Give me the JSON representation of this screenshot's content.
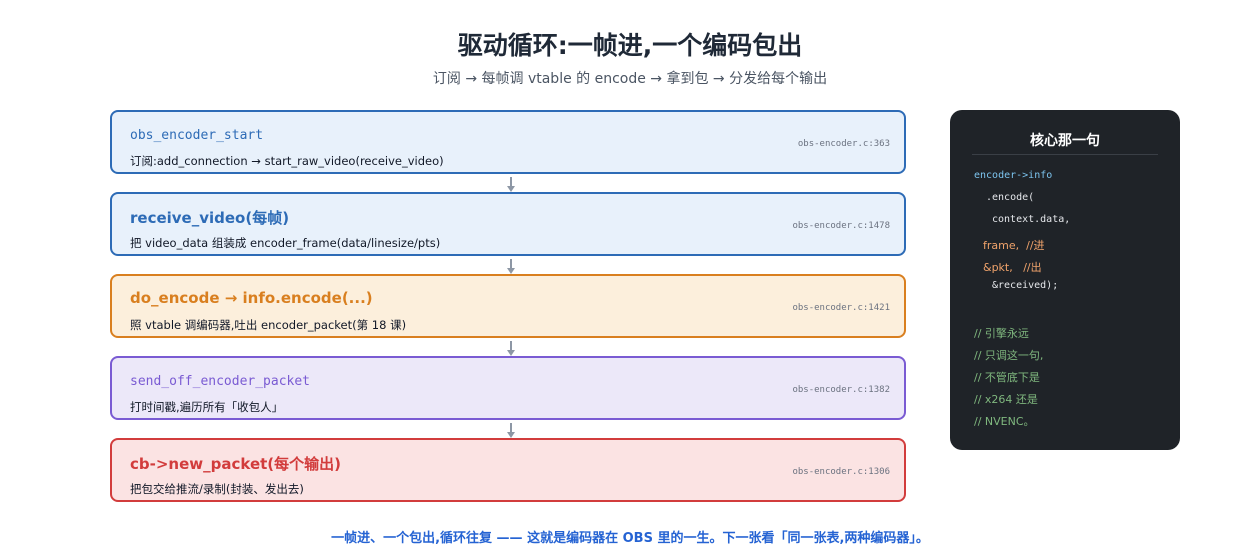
{
  "title": "驱动循环:一帧进,一个编码包出",
  "subtitle": "订阅 → 每帧调 vtable 的 encode → 拿到包 → 分发给每个输出",
  "colors": {
    "blue": "#2d6bb6",
    "orange": "#d97f1f",
    "purple": "#7a5bd3",
    "red": "#d23c3c",
    "panel_bg": "#1f2328",
    "footer": "#2563d3"
  },
  "steps": [
    {
      "name": "obs_encoder_start",
      "desc": "订阅:add_connection → start_raw_video(receive_video)",
      "ref": "obs-encoder.c:363"
    },
    {
      "name": "receive_video(每帧)",
      "desc": "把 video_data 组装成 encoder_frame(data/linesize/pts)",
      "ref": "obs-encoder.c:1478"
    },
    {
      "name": "do_encode → info.encode(...)",
      "desc": "照 vtable 调编码器,吐出 encoder_packet(第 18 课)",
      "ref": "obs-encoder.c:1421"
    },
    {
      "name": "send_off_encoder_packet",
      "desc": "打时间戳,遍历所有「收包人」",
      "ref": "obs-encoder.c:1382"
    },
    {
      "name": "cb->new_packet(每个输出)",
      "desc": "把包交给推流/录制(封装、发出去)",
      "ref": "obs-encoder.c:1306"
    }
  ],
  "arrow_icon": "arrow-down-icon",
  "panel": {
    "title": "核心那一句",
    "code": [
      "encoder->info",
      ".encode(",
      "context.data,",
      "frame,  //进",
      "&pkt,   //出",
      "&received);"
    ],
    "comments": [
      "// 引擎永远",
      "// 只调这一句,",
      "// 不管底下是",
      "// x264 还是",
      "// NVENC。"
    ]
  },
  "footer": "一帧进、一个包出,循环往复 —— 这就是编码器在 OBS 里的一生。下一张看「同一张表,两种编码器」。"
}
